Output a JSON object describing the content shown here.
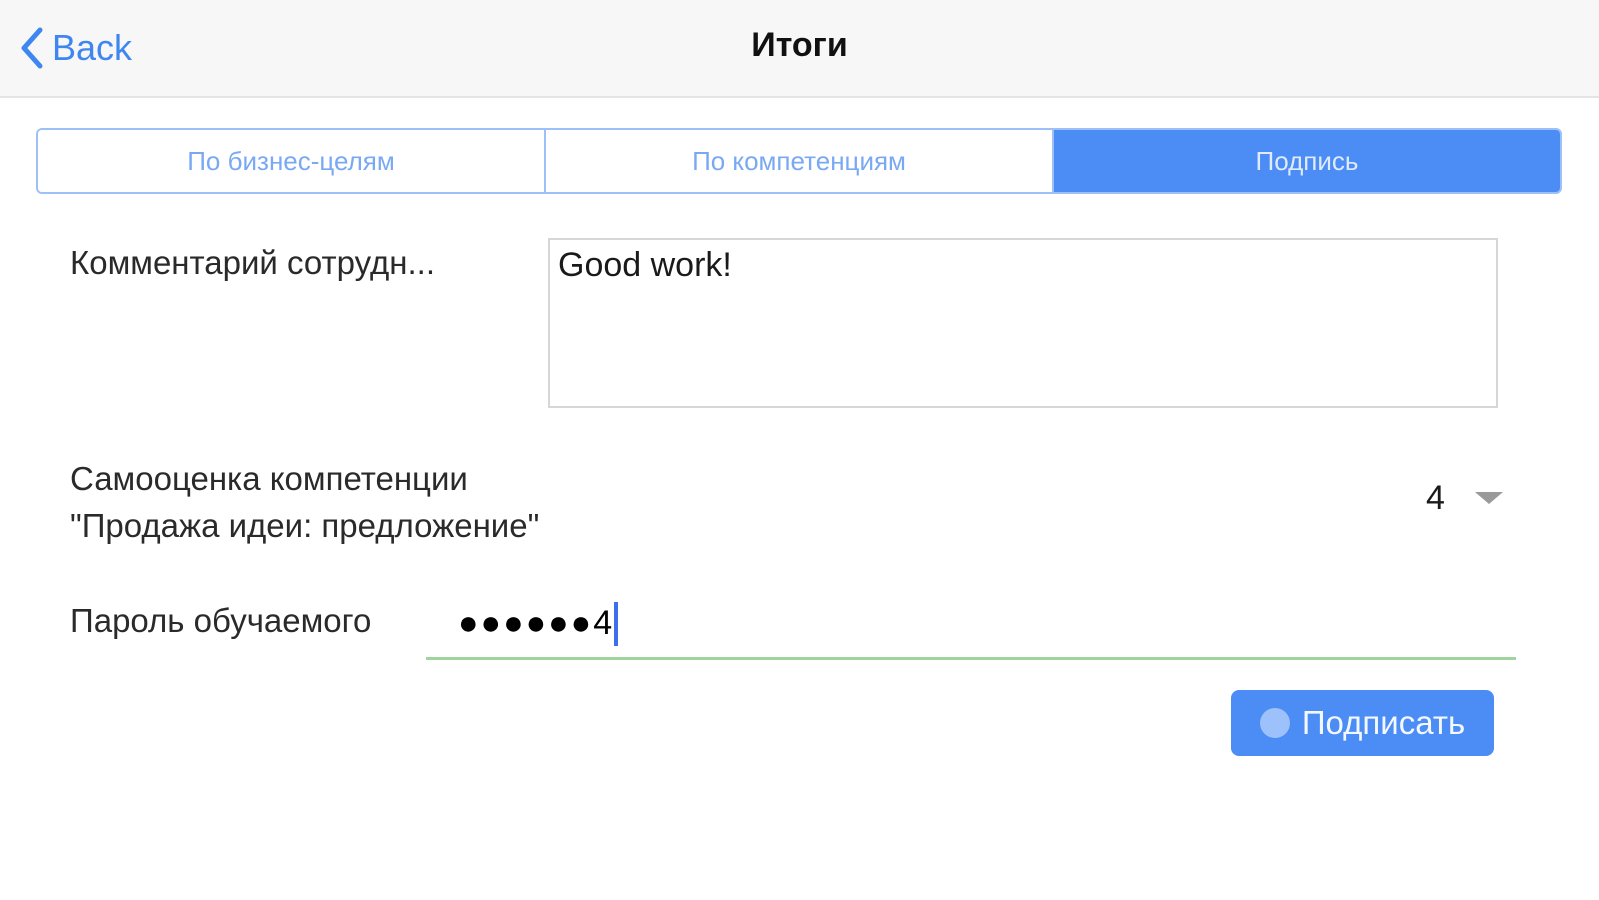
{
  "navbar": {
    "back_label": "Back",
    "title": "Итоги"
  },
  "tabs": [
    {
      "label": "По бизнес-целям",
      "active": false
    },
    {
      "label": "По компетенциям",
      "active": false
    },
    {
      "label": "Подпись",
      "active": true
    }
  ],
  "form": {
    "comment_label": "Комментарий сотрудн...",
    "comment_value": "Good work!",
    "self_assessment_label_line1": "Самооценка компетенции",
    "self_assessment_label_line2": "\"Продажа идеи: предложение\"",
    "self_assessment_value": "4",
    "password_label": "Пароль обучаемого",
    "password_masked": "●●●●●●",
    "password_last_char": "4",
    "sign_button_label": "Подписать"
  },
  "colors": {
    "accent": "#4b8df5",
    "link": "#3f86f0",
    "valid_underline": "#9fd49c"
  }
}
